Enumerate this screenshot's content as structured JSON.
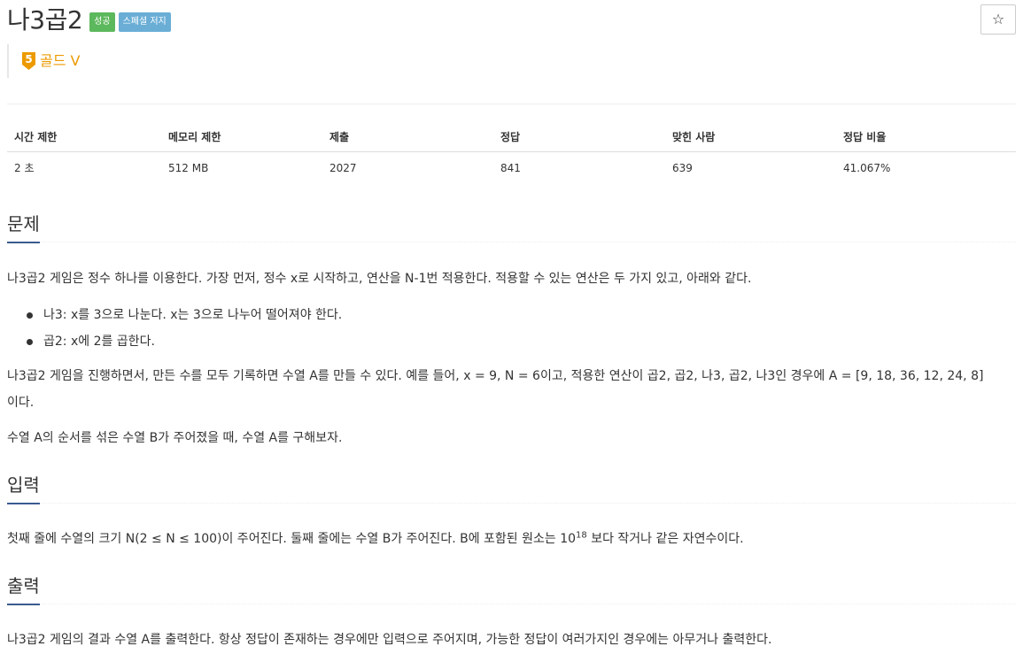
{
  "problem": {
    "title": "나3곱2",
    "badges": {
      "success": "성공",
      "special": "스페셜 저지"
    },
    "star_icon": "star-icon",
    "tier": {
      "label": "골드 V",
      "icon_number": "5",
      "icon_color": "#ec9a00"
    }
  },
  "stats": {
    "headers": [
      "시간 제한",
      "메모리 제한",
      "제출",
      "정답",
      "맞힌 사람",
      "정답 비율"
    ],
    "values": [
      "2 초",
      "512 MB",
      "2027",
      "841",
      "639",
      "41.067%"
    ]
  },
  "sections": {
    "problem": {
      "heading": "문제",
      "p1": "나3곱2 게임은 정수 하나를 이용한다. 가장 먼저, 정수 x로 시작하고, 연산을 N-1번 적용한다. 적용할 수 있는 연산은 두 가지 있고, 아래와 같다.",
      "bullets": [
        "나3: x를 3으로 나눈다. x는 3으로 나누어 떨어져야 한다.",
        "곱2: x에 2를 곱한다."
      ],
      "p2_line1": "나3곱2 게임을 진행하면서, 만든 수를 모두 기록하면 수열 A를 만들 수 있다. 예를 들어, x = 9, N = 6이고, 적용한 연산이 곱2, 곱2, 나3, 곱2, 나3인 경우에 A = [9, 18, 36, 12, 24, 8]",
      "p2_line2": "이다.",
      "p3": "수열 A의 순서를 섞은 수열 B가 주어졌을 때, 수열 A를 구해보자."
    },
    "input": {
      "heading": "입력",
      "text_before": "첫째 줄에 수열의 크기 N(2 ≤ N ≤ 100)이 주어진다. 둘째 줄에는 수열 B가 주어진다. B에 포함된 원소는 10",
      "sup": "18",
      "text_after": " 보다 작거나 같은 자연수이다."
    },
    "output": {
      "heading": "출력",
      "text": "나3곱2 게임의 결과 수열 A를 출력한다. 항상 정답이 존재하는 경우에만 입력으로 주어지며, 가능한 정답이 여러가지인 경우에는 아무거나 출력한다."
    }
  },
  "colors": {
    "success_badge": "#5cb85c",
    "special_badge": "#6aaed6",
    "heading_underline": "#395b8f",
    "tier_gold": "#ec9a00"
  }
}
